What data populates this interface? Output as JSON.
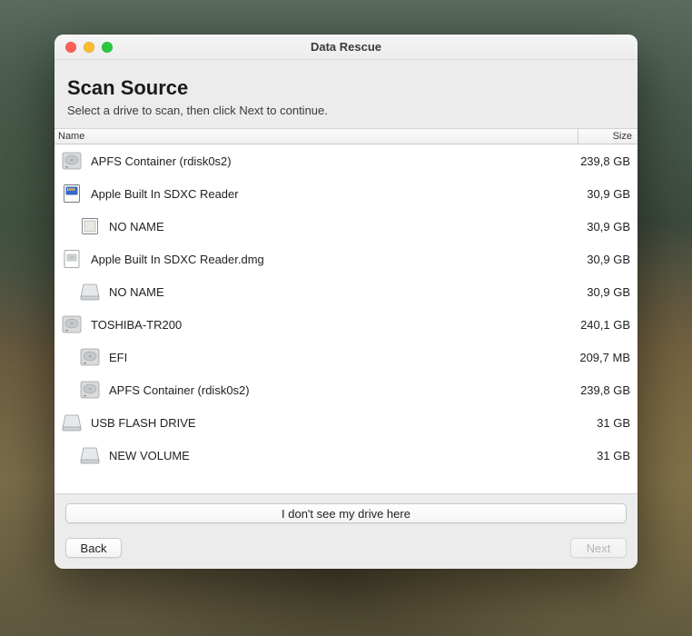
{
  "window": {
    "title": "Data Rescue"
  },
  "header": {
    "title": "Scan Source",
    "subtitle": "Select a drive to scan, then click Next to continue."
  },
  "columns": {
    "name": "Name",
    "size": "Size"
  },
  "drives": [
    {
      "icon": "hdd",
      "indent": 0,
      "name": "APFS Container (rdisk0s2)",
      "size": "239,8 GB"
    },
    {
      "icon": "sdcard",
      "indent": 0,
      "name": "Apple Built In SDXC Reader",
      "size": "30,9 GB"
    },
    {
      "icon": "volume",
      "indent": 1,
      "name": "NO NAME",
      "size": "30,9 GB"
    },
    {
      "icon": "dmg",
      "indent": 0,
      "name": "Apple Built In SDXC Reader.dmg",
      "size": "30,9 GB"
    },
    {
      "icon": "external",
      "indent": 1,
      "name": "NO NAME",
      "size": "30,9 GB"
    },
    {
      "icon": "hdd",
      "indent": 0,
      "name": "TOSHIBA-TR200",
      "size": "240,1 GB"
    },
    {
      "icon": "hdd",
      "indent": 1,
      "name": "EFI",
      "size": "209,7 MB"
    },
    {
      "icon": "hdd",
      "indent": 1,
      "name": "APFS Container (rdisk0s2)",
      "size": "239,8 GB"
    },
    {
      "icon": "external",
      "indent": 0,
      "name": "USB FLASH DRIVE",
      "size": "31 GB"
    },
    {
      "icon": "external",
      "indent": 1,
      "name": "NEW VOLUME",
      "size": "31 GB"
    }
  ],
  "footer": {
    "missing_drive": "I don't see my drive here",
    "back": "Back",
    "next": "Next"
  }
}
